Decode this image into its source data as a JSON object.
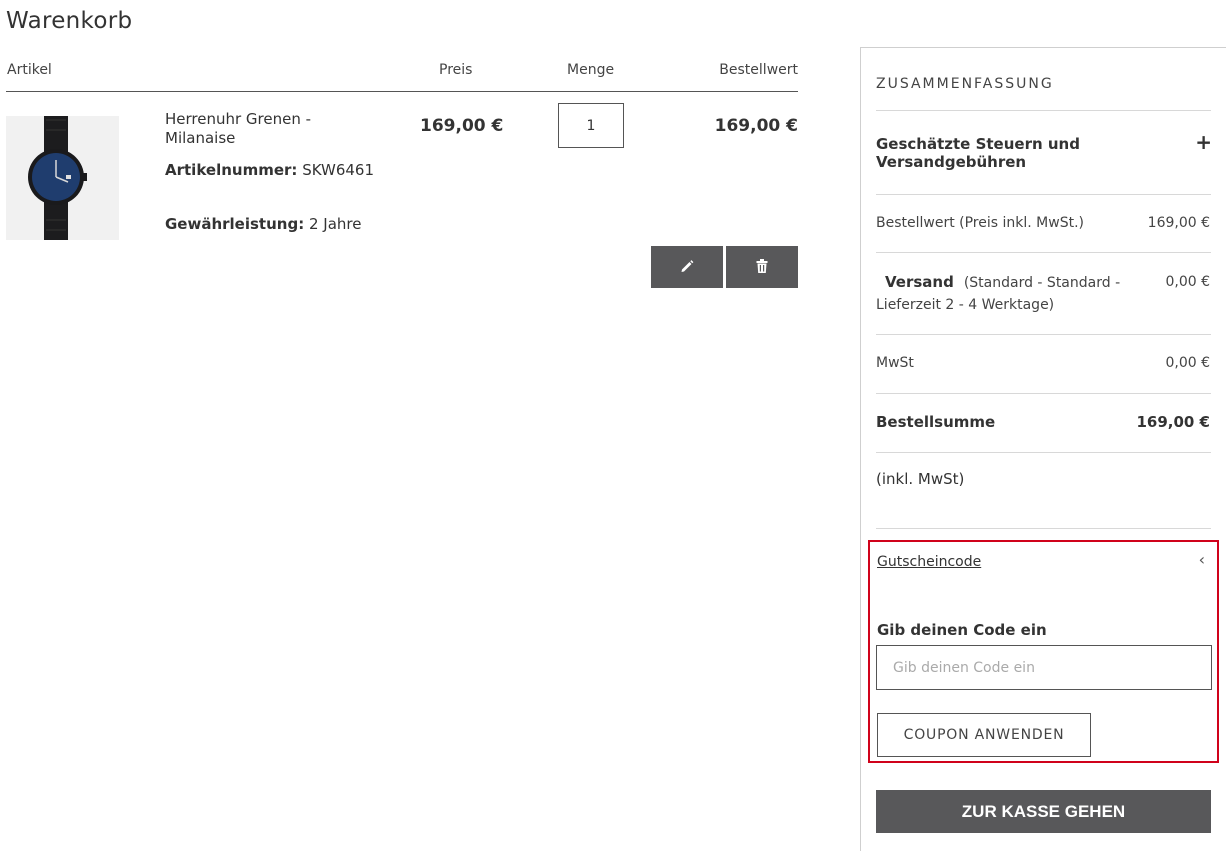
{
  "page": {
    "title": "Warenkorb"
  },
  "cart": {
    "columns": {
      "article": "Artikel",
      "price": "Preis",
      "quantity": "Menge",
      "total": "Bestellwert"
    },
    "item": {
      "name": "Herrenuhr Grenen - Milanaise",
      "sku_label": "Artikelnummer:",
      "sku": "SKW6461",
      "warranty_label": "Gewährleistung:",
      "warranty": "2 Jahre",
      "price": "169,00 €",
      "quantity": "1",
      "total": "169,00 €",
      "actions": {
        "edit_icon": "pencil-icon",
        "delete_icon": "trash-icon"
      }
    }
  },
  "summary": {
    "title": "ZUSAMMENFASSUNG",
    "tax_toggle": {
      "label": "Geschätzte Steuern und Versandgebühren",
      "icon": "+"
    },
    "subtotal": {
      "label": "Bestellwert (Preis inkl. MwSt.)",
      "value": "169,00 €"
    },
    "shipping": {
      "label": "Versand",
      "detail": "(Standard - Standard - Lieferzeit 2 - 4 Werktage)",
      "value": "0,00 €"
    },
    "vat": {
      "label": "MwSt",
      "value": "0,00 €"
    },
    "grand_total": {
      "label": "Bestellsumme",
      "value": "169,00 €"
    },
    "incl_vat": "(inkl. MwSt)",
    "coupon": {
      "link": "Gutscheincode",
      "chevron": "‹",
      "label": "Gib deinen Code ein",
      "placeholder": "Gib deinen Code ein",
      "button": "COUPON ANWENDEN"
    },
    "checkout_button": "ZUR KASSE GEHEN"
  },
  "colors": {
    "button_dark": "#58585a",
    "highlight_border": "#d0021b"
  }
}
